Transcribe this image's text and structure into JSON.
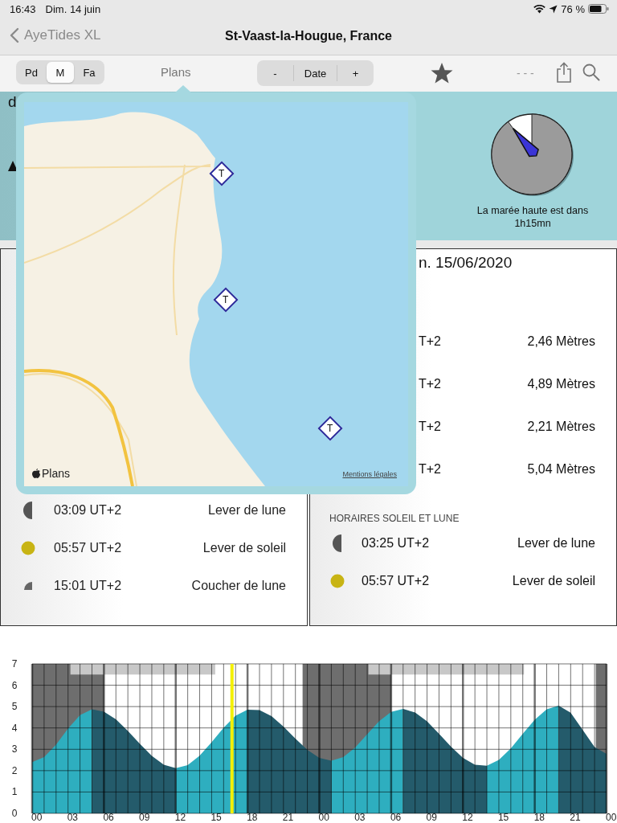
{
  "status_bar": {
    "time": "16:43",
    "date": "Dim. 14 juin",
    "battery": "76 %"
  },
  "nav": {
    "back": "AyeTides XL",
    "title": "St-Vaast-la-Hougue, France"
  },
  "toolbar": {
    "segments": [
      {
        "label": "Pd",
        "selected": false
      },
      {
        "label": "M",
        "selected": true
      },
      {
        "label": "Fa",
        "selected": false
      }
    ],
    "maps_button": "Plans",
    "stepper": {
      "minus": "-",
      "label": "Date",
      "plus": "+"
    },
    "dashes": "- - -"
  },
  "summary": {
    "partial_text": "d",
    "tide_clock": {
      "level": 0.9
    },
    "next_tide": "La marée haute est dans 1h15mn"
  },
  "map_popover": {
    "markers": [
      {
        "label": "T"
      },
      {
        "label": "T"
      },
      {
        "label": "T"
      }
    ],
    "logo": "Plans",
    "legal": "Mentions légales"
  },
  "left_panel": {
    "rows": [
      {
        "kind": "moonrise",
        "time": "03:09 UT+2",
        "event": "Lever de lune"
      },
      {
        "kind": "sunrise",
        "time": "05:57 UT+2",
        "event": "Lever de soleil"
      },
      {
        "kind": "moonset",
        "time": "15:01 UT+2",
        "event": "Coucher de lune"
      }
    ]
  },
  "right_panel": {
    "date": "n. 15/06/2020",
    "tides": [
      {
        "time": "T+2",
        "height": "2,46 Mètres"
      },
      {
        "time": "T+2",
        "height": "4,89 Mètres"
      },
      {
        "time": "T+2",
        "height": "2,21 Mètres"
      },
      {
        "time": "T+2",
        "height": "5,04 Mètres"
      }
    ],
    "section_title": "HORAIRES SOLEIL ET LUNE",
    "events": [
      {
        "kind": "moonrise",
        "time": "03:25 UT+2",
        "event": "Lever de lune"
      },
      {
        "kind": "sunrise",
        "time": "05:57 UT+2",
        "event": "Lever de soleil"
      }
    ]
  },
  "chart": {
    "chart_data": {
      "type": "area",
      "x": [
        0,
        1,
        2,
        3,
        4,
        5,
        6,
        7,
        8,
        9,
        10,
        11,
        12,
        13,
        14,
        15,
        16,
        17,
        18,
        19,
        20,
        21,
        22,
        23,
        24,
        25,
        26,
        27,
        28,
        29,
        30,
        31,
        32,
        33,
        34,
        35,
        36,
        37,
        38,
        39,
        40,
        41,
        42,
        43,
        44,
        45,
        46,
        47,
        48
      ],
      "grid": true,
      "series": [
        {
          "color": "#2eaebf",
          "values": [
            2.4,
            2.63,
            3.22,
            3.97,
            4.6,
            4.87,
            null,
            null,
            null,
            null,
            null,
            null,
            2.12,
            2.26,
            2.7,
            3.33,
            4.01,
            4.57,
            4.86,
            null,
            null,
            null,
            null,
            null,
            null,
            2.46,
            2.63,
            3.09,
            3.71,
            4.32,
            4.75,
            4.89,
            null,
            null,
            null,
            null,
            null,
            null,
            2.23,
            2.5,
            3.04,
            3.73,
            4.39,
            4.87,
            5.04,
            null,
            null,
            null,
            null
          ]
        },
        {
          "color": "#245b6b",
          "values": [
            null,
            null,
            null,
            null,
            null,
            4.87,
            4.76,
            4.4,
            3.86,
            3.25,
            2.69,
            2.28,
            2.12,
            null,
            null,
            null,
            null,
            null,
            4.86,
            4.84,
            4.55,
            4.07,
            3.5,
            2.97,
            2.6,
            2.46,
            null,
            null,
            null,
            null,
            null,
            4.89,
            4.72,
            4.31,
            3.73,
            3.12,
            2.6,
            2.28,
            2.23,
            null,
            null,
            null,
            null,
            null,
            5.04,
            4.71,
            3.91,
            3.11,
            2.78
          ]
        }
      ],
      "bands": [
        {
          "axis": "x",
          "from": 0,
          "to": 6.0,
          "color": "#6e6e6e"
        },
        {
          "axis": "x",
          "from": 22.6,
          "to": 30.0,
          "color": "#6e6e6e"
        },
        {
          "axis": "x",
          "from": 47.1,
          "to": 48,
          "color": "#6e6e6e"
        },
        {
          "axis": "x",
          "from": 3.2,
          "to": 15.3,
          "color": "#c8c8c8"
        },
        {
          "axis": "x",
          "from": 28.1,
          "to": 41.1,
          "color": "#c8c8c8"
        }
      ],
      "ref_lines": [
        {
          "axis": "x",
          "value": 16.7,
          "color": "#f4f000"
        }
      ],
      "xlim": [
        0,
        48
      ],
      "ylim": [
        0,
        7
      ],
      "xticks": [
        {
          "value": 0,
          "label": "00"
        },
        {
          "value": 3,
          "label": "03"
        },
        {
          "value": 6,
          "label": "06"
        },
        {
          "value": 9,
          "label": "09"
        },
        {
          "value": 12,
          "label": "12"
        },
        {
          "value": 15,
          "label": "15"
        },
        {
          "value": 18,
          "label": "18"
        },
        {
          "value": 21,
          "label": "21"
        },
        {
          "value": 24,
          "label": "00"
        },
        {
          "value": 27,
          "label": "03"
        },
        {
          "value": 30,
          "label": "06"
        },
        {
          "value": 33,
          "label": "09"
        },
        {
          "value": 36,
          "label": "12"
        },
        {
          "value": 39,
          "label": "15"
        },
        {
          "value": 42,
          "label": "18"
        },
        {
          "value": 45,
          "label": "21"
        },
        {
          "value": 48,
          "label": "00"
        }
      ],
      "yticks": [
        0,
        1,
        2,
        3,
        4,
        5,
        6,
        7
      ]
    }
  }
}
